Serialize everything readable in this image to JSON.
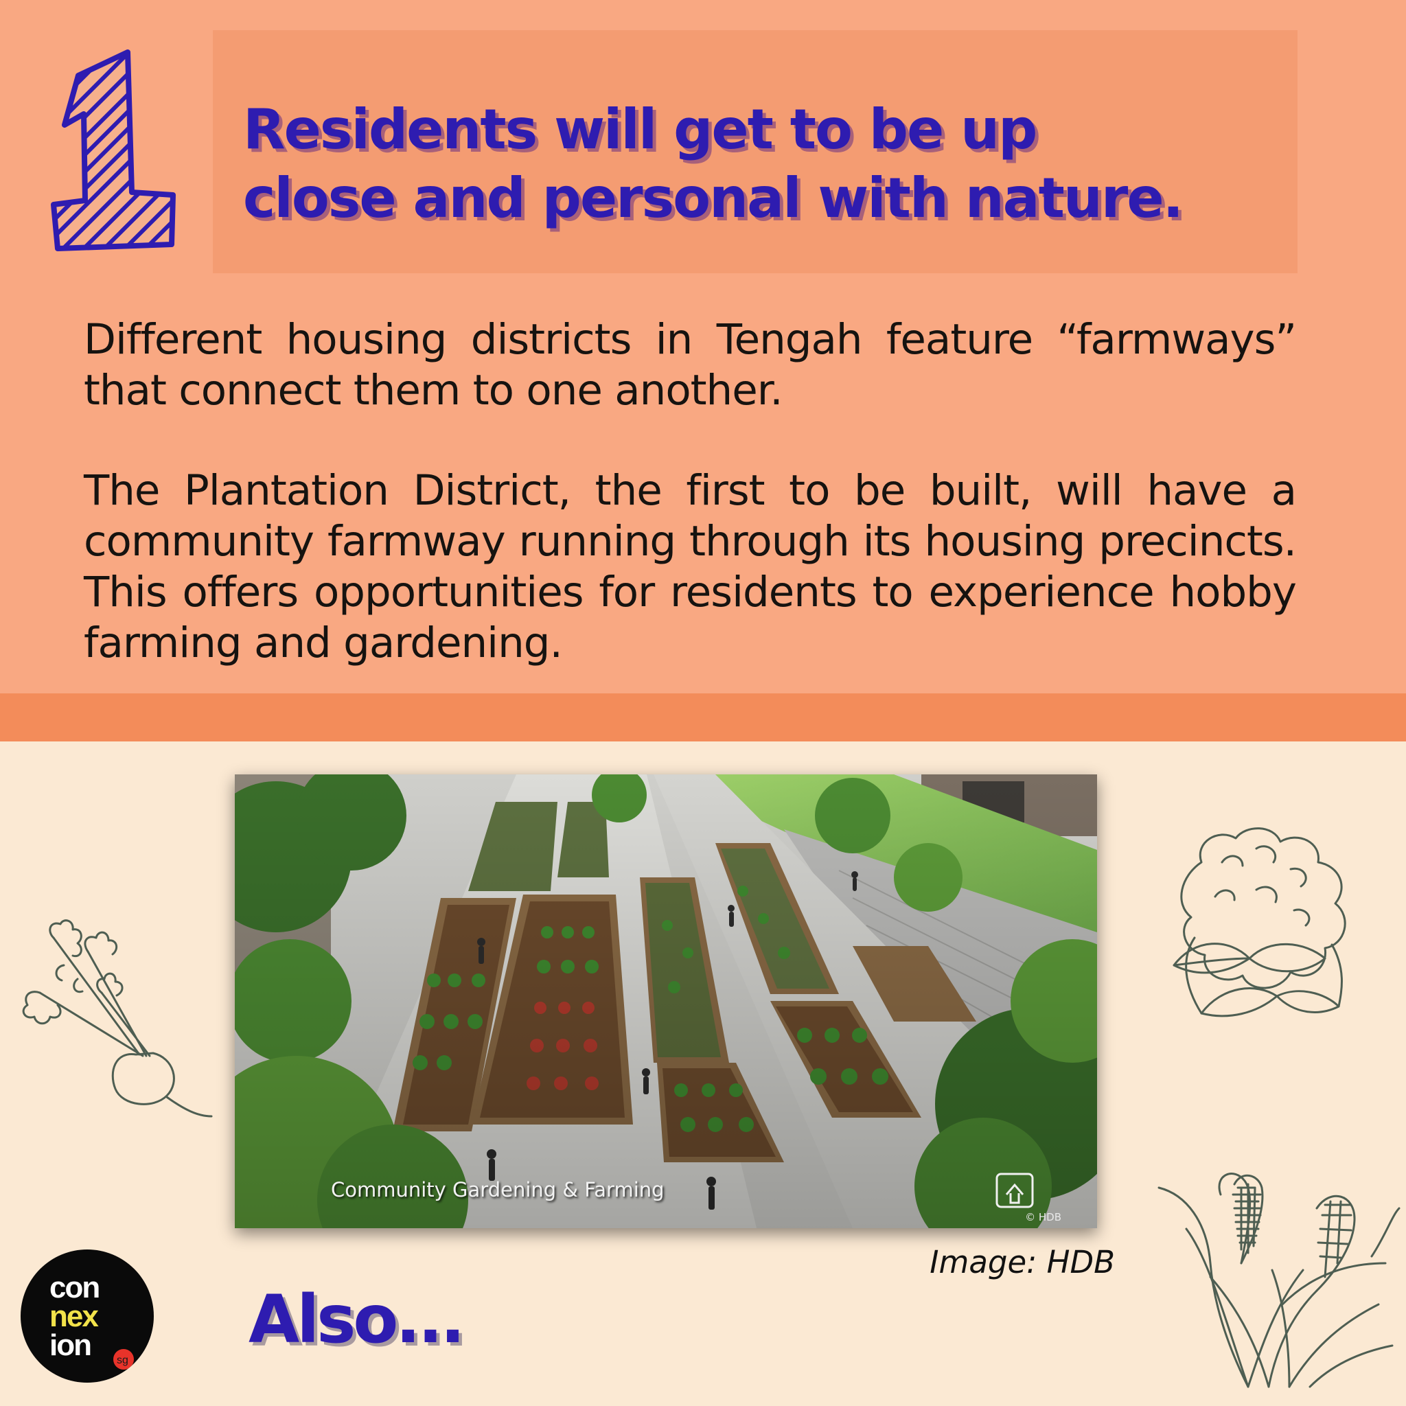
{
  "header": {
    "number": "1",
    "title": "Residents will get to be up\nclose and personal with nature."
  },
  "body": {
    "paragraph_1": "Different housing districts in Tengah feature “farmways” that connect them to one another.",
    "paragraph_2": "The Plantation District, the first to be built, will have a community farmway running through its housing precincts. This offers opportunities for residents to experience hobby farming and gardening."
  },
  "photo": {
    "caption": "Community Gardening & Farming",
    "copyright": "© HDB",
    "credit": "Image: HDB"
  },
  "footer": {
    "also": "Also..."
  },
  "logo": {
    "lines": [
      "con",
      "nex",
      "ion"
    ],
    "suffix": "sg"
  },
  "colors": {
    "top_background": "#f9a882",
    "heading_box": "#f49c72",
    "strip": "#f38c5a",
    "bottom_background": "#fbe9d3",
    "heading_text": "#2e1cb0",
    "illustration_stroke": "#4e5e52"
  }
}
